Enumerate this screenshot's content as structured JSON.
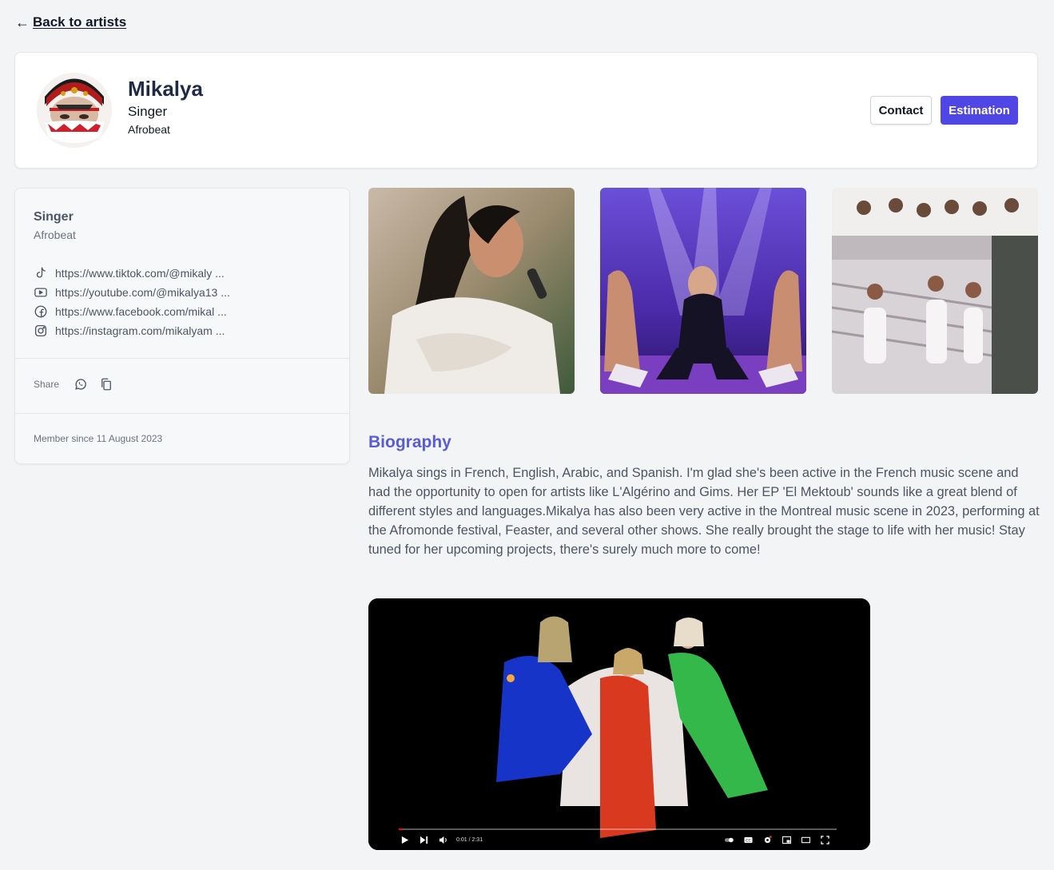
{
  "nav": {
    "back_arrow": "←",
    "back_label": "Back to artists"
  },
  "artist": {
    "name": "Mikalya",
    "role": "Singer",
    "genre": "Afrobeat",
    "avatar_icon": "avatar-portrait"
  },
  "actions": {
    "contact_label": "Contact",
    "estimation_label": "Estimation",
    "accent_color": "#4f46e5"
  },
  "sidebar": {
    "role": "Singer",
    "genre": "Afrobeat",
    "social_links": [
      {
        "icon": "tiktok-icon",
        "text": "https://www.tiktok.com/@mikaly ..."
      },
      {
        "icon": "youtube-icon",
        "text": "https://youtube.com/@mikalya13 ..."
      },
      {
        "icon": "facebook-icon",
        "text": "https://www.facebook.com/mikal ..."
      },
      {
        "icon": "instagram-icon",
        "text": "https://instagram.com/mikalyam ..."
      }
    ],
    "share_label": "Share",
    "member_since": "Member since 11 August 2023"
  },
  "gallery": [
    {
      "name": "photo-singer-microphone"
    },
    {
      "name": "photo-stage-performance"
    },
    {
      "name": "photo-dancers-outdoor"
    }
  ],
  "biography": {
    "title": "Biography",
    "text": "Mikalya sings in French, English, Arabic, and Spanish. I'm glad she's been active in the French music scene and had the opportunity to open for artists like L'Algérino and Gims. Her EP 'El Mektoub' sounds like a great blend of different styles and languages.Mikalya has also been very active in the Montreal music scene in 2023, performing at the Afromonde festival, Feaster, and several other shows. She really brought the stage to life with her music! Stay tuned for her upcoming projects, there's surely much more to come!"
  },
  "video": {
    "time": "0:01 / 2:31",
    "progress": 0.01,
    "progress_color": "#ff0000"
  }
}
